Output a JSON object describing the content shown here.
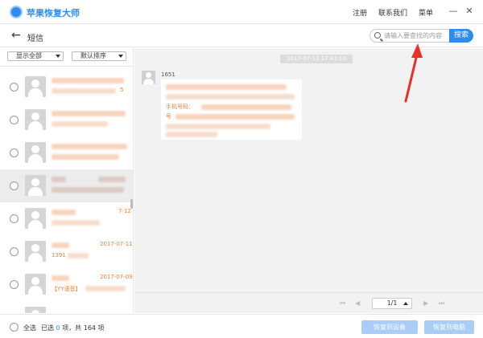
{
  "app": {
    "title": "苹果恢复大师",
    "links": [
      "注册",
      "联系我们",
      "菜单"
    ],
    "minimize_glyph": "—",
    "close_glyph": "✕"
  },
  "nav": {
    "back_glyph": "←",
    "title": "短信"
  },
  "search": {
    "placeholder": "请输入要查找的内容",
    "button_label": "搜索"
  },
  "filters": {
    "show_label": "显示全部",
    "sort_label": "默认排序"
  },
  "contacts": [
    {
      "date": "",
      "text": "5"
    },
    {
      "date": "",
      "text": ""
    },
    {
      "date": "",
      "text": ""
    },
    {
      "date": "",
      "text": ""
    },
    {
      "date": "7-12",
      "text": ""
    },
    {
      "date": "2017-07-11",
      "text": "1391"
    },
    {
      "date": "2017-07-09",
      "text": "【YY语音】"
    }
  ],
  "conversation": {
    "timestamp": "2017-07-12 17:43:10",
    "sender": "1651",
    "line1": "手机号码：",
    "line2": "号"
  },
  "pager": {
    "page": "1/1",
    "first_glyph": "⏮",
    "prev_glyph": "◀",
    "next_glyph": "▶",
    "last_glyph": "⏭"
  },
  "footer": {
    "select_all": "全选",
    "selected_prefix": "已选",
    "selected_count": "0",
    "selected_suffix": "项，共 164 项",
    "recover_device": "恢复到设备",
    "recover_pc": "恢复到电脑"
  },
  "colors": {
    "accent": "#2d8cf0",
    "highlight_text": "#f08030",
    "annotation_arrow": "#e8302a"
  }
}
